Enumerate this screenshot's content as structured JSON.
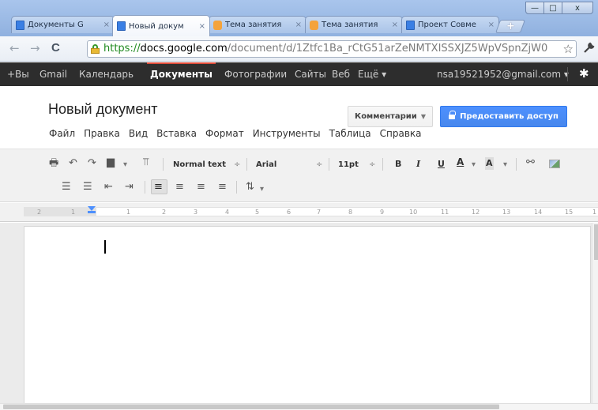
{
  "browser": {
    "tabs": [
      {
        "title": "Документы G",
        "icon": "docs-icon"
      },
      {
        "title": "Новый докум",
        "icon": "docs-icon",
        "active": true
      },
      {
        "title": "Тема занятия",
        "icon": "orange-app-icon"
      },
      {
        "title": "Тема занятия",
        "icon": "orange-app-icon"
      },
      {
        "title": "Проект Совме",
        "icon": "docs-icon"
      }
    ],
    "close_glyph": "×",
    "new_tab_glyph": "+",
    "window_buttons": {
      "minimize": "—",
      "maximize": "□",
      "close": "x"
    },
    "back_glyph": "←",
    "forward_glyph": "→",
    "reload_glyph": "C",
    "url_scheme": "https://",
    "url_host": "docs.google.com",
    "url_path": "/document/d/1Ztfc1Ba_rCtG51arZeNMTXISSXJZ5WpVSpnZjW0",
    "star_glyph": "☆",
    "wrench_glyph": "🔧"
  },
  "google_bar": {
    "items": [
      "+Вы",
      "Gmail",
      "Календарь",
      "Документы",
      "Фотографии",
      "Сайты",
      "Веб",
      "Ещё ▾"
    ],
    "active_item": "Документы",
    "account": "nsa19521952@gmail.com ▾",
    "gear_glyph": "✱"
  },
  "document": {
    "title": "Новый документ",
    "menu": [
      "Файл",
      "Правка",
      "Вид",
      "Вставка",
      "Формат",
      "Инструменты",
      "Таблица",
      "Справка"
    ],
    "comments_button": "Комментарии",
    "share_button": "Предоставить доступ",
    "colors": {
      "share": "#4d90fe",
      "gbar": "#2d2d2d",
      "gbar_accent": "#dd4b39"
    }
  },
  "toolbar": {
    "style": "Normal text",
    "font": "Arial",
    "size": "11pt",
    "bold": "B",
    "italic": "I",
    "underline": "U",
    "text_color": "A",
    "highlight": "A",
    "caret": "▾",
    "updown": "÷",
    "icons": [
      "print-icon",
      "undo-icon",
      "redo-icon",
      "paint-format-icon",
      "link-icon",
      "image-icon",
      "numbered-list-icon",
      "bulleted-list-icon",
      "decrease-indent-icon",
      "increase-indent-icon",
      "align-left-icon",
      "align-center-icon",
      "align-right-icon",
      "justify-icon",
      "line-spacing-icon"
    ]
  },
  "ruler": {
    "labels": [
      "2",
      "1",
      "1",
      "1",
      "2",
      "3",
      "4",
      "5",
      "6",
      "7",
      "8",
      "9",
      "10",
      "11",
      "12",
      "13",
      "14",
      "15",
      "1"
    ]
  }
}
